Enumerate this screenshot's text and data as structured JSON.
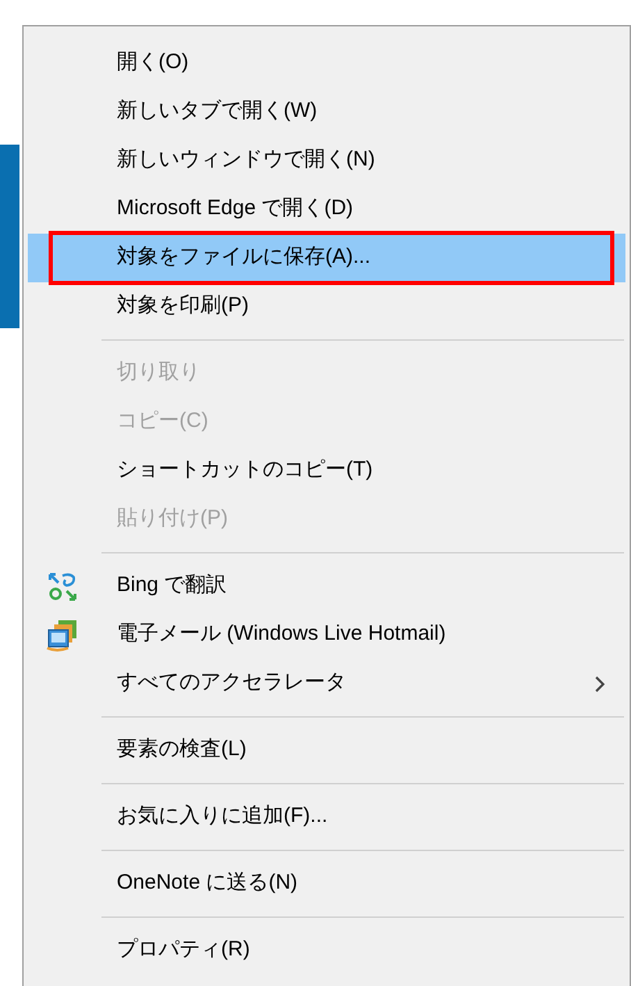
{
  "context_menu": {
    "items": [
      {
        "kind": "item",
        "label": "開く(O)",
        "disabled": false,
        "selected": false,
        "outlined": false,
        "submenu": false
      },
      {
        "kind": "item",
        "label": "新しいタブで開く(W)",
        "disabled": false,
        "selected": false,
        "outlined": false,
        "submenu": false
      },
      {
        "kind": "item",
        "label": "新しいウィンドウで開く(N)",
        "disabled": false,
        "selected": false,
        "outlined": false,
        "submenu": false
      },
      {
        "kind": "item",
        "label": "Microsoft Edge で開く(D)",
        "disabled": false,
        "selected": false,
        "outlined": false,
        "submenu": false
      },
      {
        "kind": "item",
        "label": "対象をファイルに保存(A)...",
        "disabled": false,
        "selected": true,
        "outlined": true,
        "submenu": false
      },
      {
        "kind": "item",
        "label": "対象を印刷(P)",
        "disabled": false,
        "selected": false,
        "outlined": false,
        "submenu": false
      },
      {
        "kind": "separator"
      },
      {
        "kind": "item",
        "label": "切り取り",
        "disabled": true,
        "selected": false,
        "outlined": false,
        "submenu": false
      },
      {
        "kind": "item",
        "label": "コピー(C)",
        "disabled": true,
        "selected": false,
        "outlined": false,
        "submenu": false
      },
      {
        "kind": "item",
        "label": "ショートカットのコピー(T)",
        "disabled": false,
        "selected": false,
        "outlined": false,
        "submenu": false
      },
      {
        "kind": "item",
        "label": "貼り付け(P)",
        "disabled": true,
        "selected": false,
        "outlined": false,
        "submenu": false
      },
      {
        "kind": "separator"
      },
      {
        "kind": "translate",
        "label": "Bing で翻訳",
        "disabled": false,
        "selected": false,
        "outlined": false,
        "submenu": false
      },
      {
        "kind": "mail",
        "label": "電子メール (Windows Live Hotmail)",
        "disabled": false,
        "selected": false,
        "outlined": false,
        "submenu": false
      },
      {
        "kind": "item",
        "label": "すべてのアクセラレータ",
        "disabled": false,
        "selected": false,
        "outlined": false,
        "submenu": true
      },
      {
        "kind": "separator"
      },
      {
        "kind": "item",
        "label": "要素の検査(L)",
        "disabled": false,
        "selected": false,
        "outlined": false,
        "submenu": false
      },
      {
        "kind": "separator"
      },
      {
        "kind": "item",
        "label": "お気に入りに追加(F)...",
        "disabled": false,
        "selected": false,
        "outlined": false,
        "submenu": false
      },
      {
        "kind": "separator"
      },
      {
        "kind": "item",
        "label": "OneNote に送る(N)",
        "disabled": false,
        "selected": false,
        "outlined": false,
        "submenu": false
      },
      {
        "kind": "separator"
      },
      {
        "kind": "item",
        "label": "プロパティ(R)",
        "disabled": false,
        "selected": false,
        "outlined": false,
        "submenu": false
      }
    ]
  }
}
